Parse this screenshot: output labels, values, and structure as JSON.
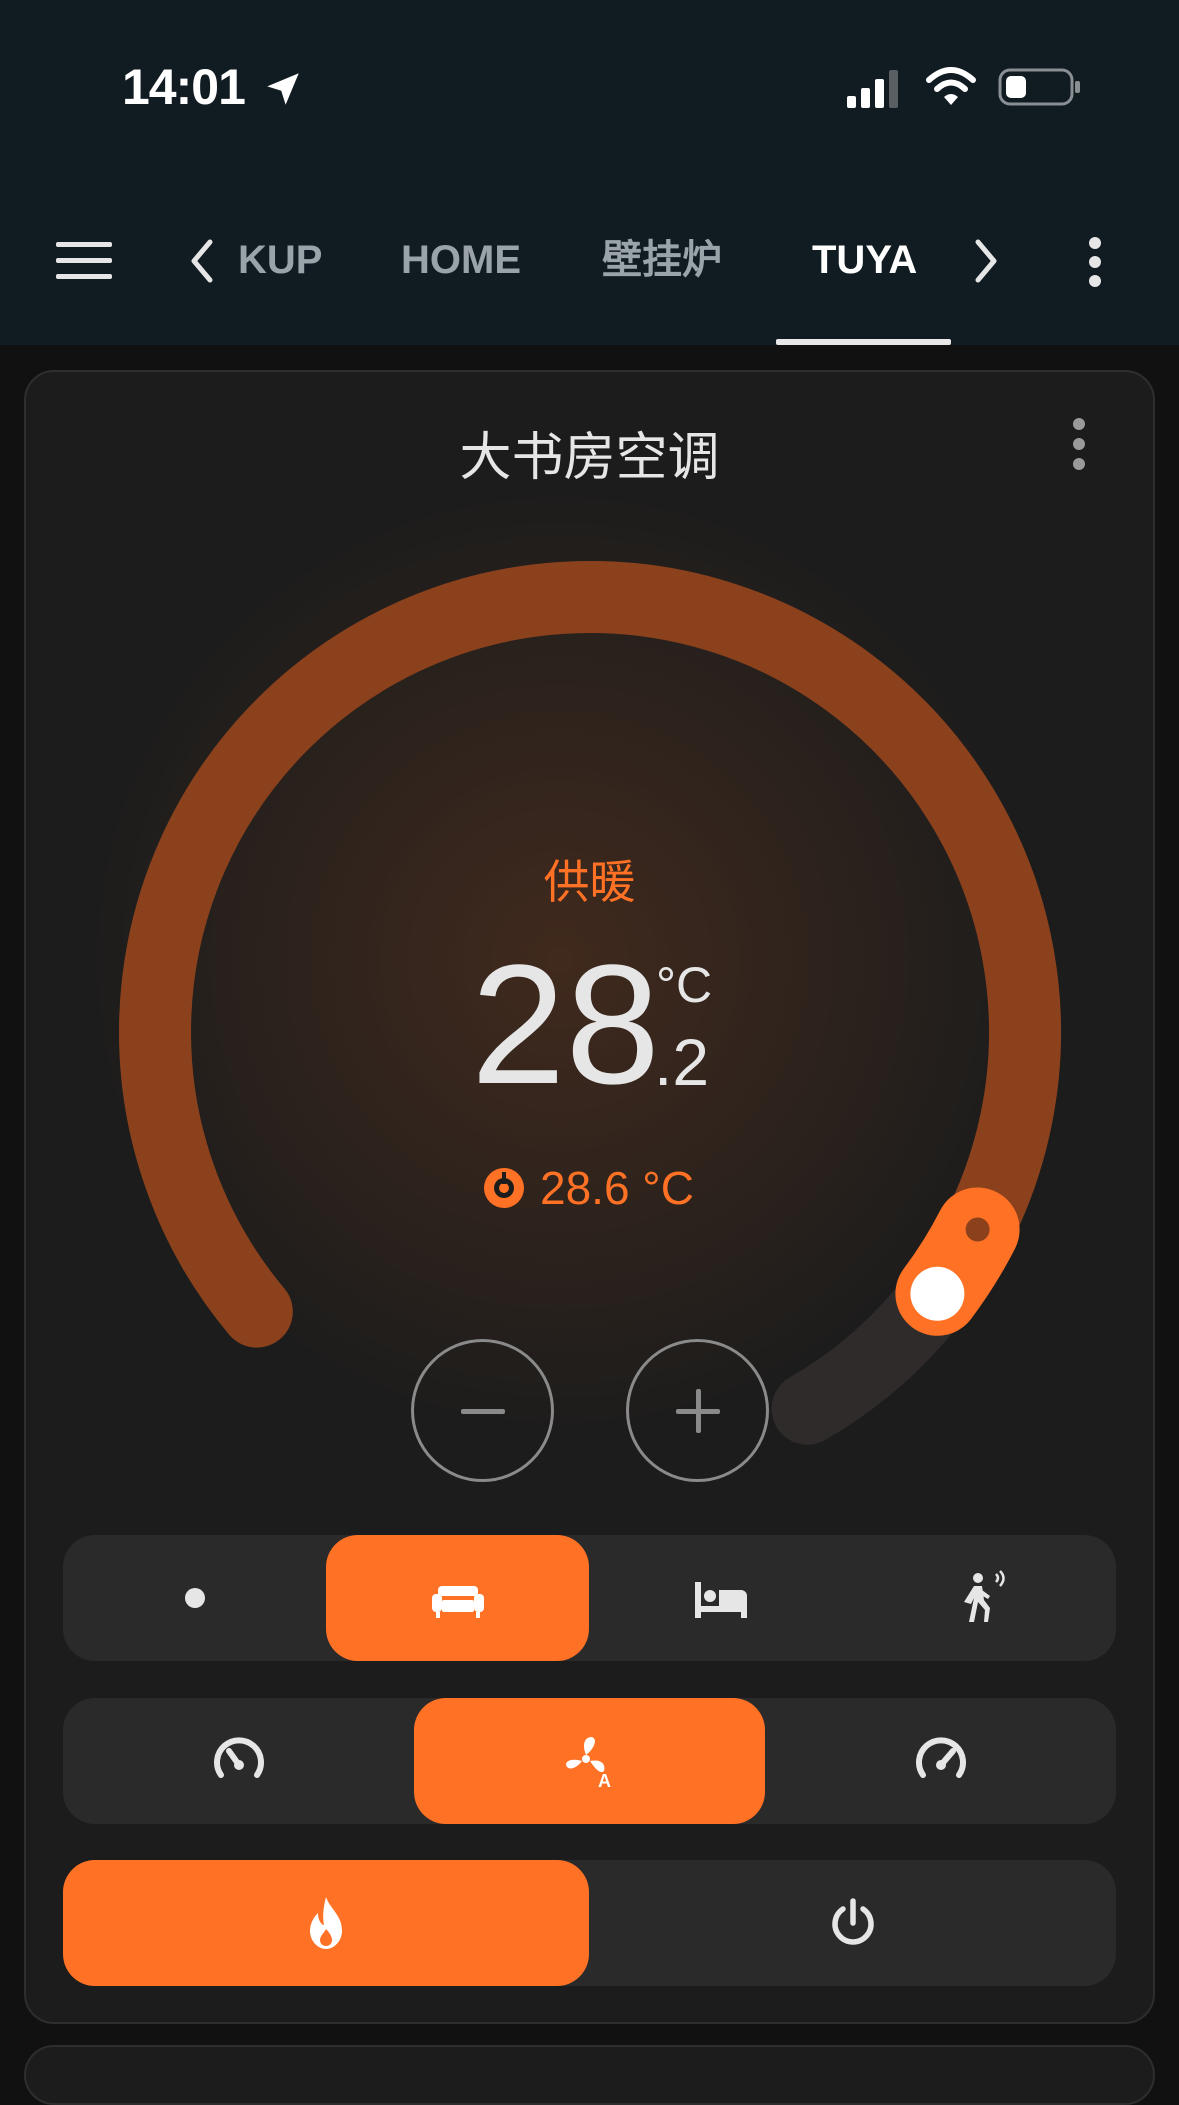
{
  "status_bar": {
    "time": "14:01",
    "icons": [
      "location-arrow-icon",
      "cellular-signal-icon",
      "wifi-icon",
      "battery-icon"
    ]
  },
  "header": {
    "menu_icon": "hamburger-menu-icon",
    "tabs": [
      {
        "label": "KUP",
        "active": false
      },
      {
        "label": "HOME",
        "active": false
      },
      {
        "label": "壁挂炉",
        "active": false
      },
      {
        "label": "TUYA",
        "active": true
      }
    ],
    "prev_icon": "chevron-left-icon",
    "next_icon": "chevron-right-icon",
    "overflow_icon": "vertical-ellipsis-icon"
  },
  "thermostat": {
    "title": "大书房空调",
    "mode_label": "供暖",
    "target_integer": "28",
    "target_decimal": ".2",
    "unit": "°C",
    "current_temperature": "28.6 °C",
    "current_icon": "thermometer-icon",
    "dial_level": 0.9,
    "decrease_icon": "minus-icon",
    "increase_icon": "plus-icon"
  },
  "preset_modes": [
    {
      "icon": "dot-icon",
      "active": false
    },
    {
      "icon": "sofa-icon",
      "active": true
    },
    {
      "icon": "bed-icon",
      "active": false
    },
    {
      "icon": "walking-person-icon",
      "active": false
    }
  ],
  "fan_modes": [
    {
      "icon": "speedometer-low-icon",
      "active": false
    },
    {
      "icon": "fan-auto-icon",
      "active": true
    },
    {
      "icon": "speedometer-high-icon",
      "active": false
    }
  ],
  "hvac_modes": [
    {
      "icon": "flame-icon",
      "active": true
    },
    {
      "icon": "power-icon",
      "active": false
    }
  ],
  "colors": {
    "accent": "#ff7124",
    "arc_track": "#8b411c",
    "header_bg": "#111b22",
    "card_bg": "#1c1c1c",
    "segment_bg": "#2a2a2a"
  }
}
